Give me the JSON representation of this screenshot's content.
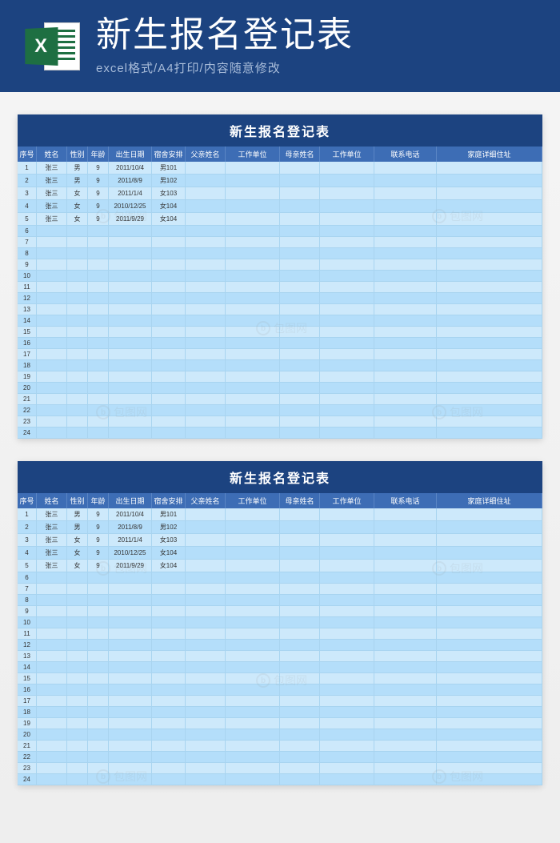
{
  "banner": {
    "title": "新生报名登记表",
    "subtitle": "excel格式/A4打印/内容随意修改",
    "icon_letter": "X"
  },
  "sheet": {
    "title": "新生报名登记表",
    "headers": {
      "seq": "序号",
      "name": "姓名",
      "sex": "性别",
      "age": "年龄",
      "birth": "出生日期",
      "dorm": "宿舍安排",
      "fname": "父亲姓名",
      "work1": "工作单位",
      "mname": "母亲姓名",
      "work2": "工作单位",
      "phone": "联系电话",
      "addr": "家庭详细住址"
    },
    "rows": [
      {
        "seq": "1",
        "name": "张三",
        "sex": "男",
        "age": "9",
        "birth": "2011/10/4",
        "dorm": "男101",
        "fname": "",
        "work1": "",
        "mname": "",
        "work2": "",
        "phone": "",
        "addr": ""
      },
      {
        "seq": "2",
        "name": "张三",
        "sex": "男",
        "age": "9",
        "birth": "2011/8/9",
        "dorm": "男102",
        "fname": "",
        "work1": "",
        "mname": "",
        "work2": "",
        "phone": "",
        "addr": ""
      },
      {
        "seq": "3",
        "name": "张三",
        "sex": "女",
        "age": "9",
        "birth": "2011/1/4",
        "dorm": "女103",
        "fname": "",
        "work1": "",
        "mname": "",
        "work2": "",
        "phone": "",
        "addr": ""
      },
      {
        "seq": "4",
        "name": "张三",
        "sex": "女",
        "age": "9",
        "birth": "2010/12/25",
        "dorm": "女104",
        "fname": "",
        "work1": "",
        "mname": "",
        "work2": "",
        "phone": "",
        "addr": ""
      },
      {
        "seq": "5",
        "name": "张三",
        "sex": "女",
        "age": "9",
        "birth": "2011/9/29",
        "dorm": "女104",
        "fname": "",
        "work1": "",
        "mname": "",
        "work2": "",
        "phone": "",
        "addr": ""
      },
      {
        "seq": "6",
        "name": "",
        "sex": "",
        "age": "",
        "birth": "",
        "dorm": "",
        "fname": "",
        "work1": "",
        "mname": "",
        "work2": "",
        "phone": "",
        "addr": ""
      },
      {
        "seq": "7",
        "name": "",
        "sex": "",
        "age": "",
        "birth": "",
        "dorm": "",
        "fname": "",
        "work1": "",
        "mname": "",
        "work2": "",
        "phone": "",
        "addr": ""
      },
      {
        "seq": "8",
        "name": "",
        "sex": "",
        "age": "",
        "birth": "",
        "dorm": "",
        "fname": "",
        "work1": "",
        "mname": "",
        "work2": "",
        "phone": "",
        "addr": ""
      },
      {
        "seq": "9",
        "name": "",
        "sex": "",
        "age": "",
        "birth": "",
        "dorm": "",
        "fname": "",
        "work1": "",
        "mname": "",
        "work2": "",
        "phone": "",
        "addr": ""
      },
      {
        "seq": "10",
        "name": "",
        "sex": "",
        "age": "",
        "birth": "",
        "dorm": "",
        "fname": "",
        "work1": "",
        "mname": "",
        "work2": "",
        "phone": "",
        "addr": ""
      },
      {
        "seq": "11",
        "name": "",
        "sex": "",
        "age": "",
        "birth": "",
        "dorm": "",
        "fname": "",
        "work1": "",
        "mname": "",
        "work2": "",
        "phone": "",
        "addr": ""
      },
      {
        "seq": "12",
        "name": "",
        "sex": "",
        "age": "",
        "birth": "",
        "dorm": "",
        "fname": "",
        "work1": "",
        "mname": "",
        "work2": "",
        "phone": "",
        "addr": ""
      },
      {
        "seq": "13",
        "name": "",
        "sex": "",
        "age": "",
        "birth": "",
        "dorm": "",
        "fname": "",
        "work1": "",
        "mname": "",
        "work2": "",
        "phone": "",
        "addr": ""
      },
      {
        "seq": "14",
        "name": "",
        "sex": "",
        "age": "",
        "birth": "",
        "dorm": "",
        "fname": "",
        "work1": "",
        "mname": "",
        "work2": "",
        "phone": "",
        "addr": ""
      },
      {
        "seq": "15",
        "name": "",
        "sex": "",
        "age": "",
        "birth": "",
        "dorm": "",
        "fname": "",
        "work1": "",
        "mname": "",
        "work2": "",
        "phone": "",
        "addr": ""
      },
      {
        "seq": "16",
        "name": "",
        "sex": "",
        "age": "",
        "birth": "",
        "dorm": "",
        "fname": "",
        "work1": "",
        "mname": "",
        "work2": "",
        "phone": "",
        "addr": ""
      },
      {
        "seq": "17",
        "name": "",
        "sex": "",
        "age": "",
        "birth": "",
        "dorm": "",
        "fname": "",
        "work1": "",
        "mname": "",
        "work2": "",
        "phone": "",
        "addr": ""
      },
      {
        "seq": "18",
        "name": "",
        "sex": "",
        "age": "",
        "birth": "",
        "dorm": "",
        "fname": "",
        "work1": "",
        "mname": "",
        "work2": "",
        "phone": "",
        "addr": ""
      },
      {
        "seq": "19",
        "name": "",
        "sex": "",
        "age": "",
        "birth": "",
        "dorm": "",
        "fname": "",
        "work1": "",
        "mname": "",
        "work2": "",
        "phone": "",
        "addr": ""
      },
      {
        "seq": "20",
        "name": "",
        "sex": "",
        "age": "",
        "birth": "",
        "dorm": "",
        "fname": "",
        "work1": "",
        "mname": "",
        "work2": "",
        "phone": "",
        "addr": ""
      },
      {
        "seq": "21",
        "name": "",
        "sex": "",
        "age": "",
        "birth": "",
        "dorm": "",
        "fname": "",
        "work1": "",
        "mname": "",
        "work2": "",
        "phone": "",
        "addr": ""
      },
      {
        "seq": "22",
        "name": "",
        "sex": "",
        "age": "",
        "birth": "",
        "dorm": "",
        "fname": "",
        "work1": "",
        "mname": "",
        "work2": "",
        "phone": "",
        "addr": ""
      },
      {
        "seq": "23",
        "name": "",
        "sex": "",
        "age": "",
        "birth": "",
        "dorm": "",
        "fname": "",
        "work1": "",
        "mname": "",
        "work2": "",
        "phone": "",
        "addr": ""
      },
      {
        "seq": "24",
        "name": "",
        "sex": "",
        "age": "",
        "birth": "",
        "dorm": "",
        "fname": "",
        "work1": "",
        "mname": "",
        "work2": "",
        "phone": "",
        "addr": ""
      }
    ]
  },
  "watermark": {
    "text": "包图网",
    "icon": "b"
  }
}
